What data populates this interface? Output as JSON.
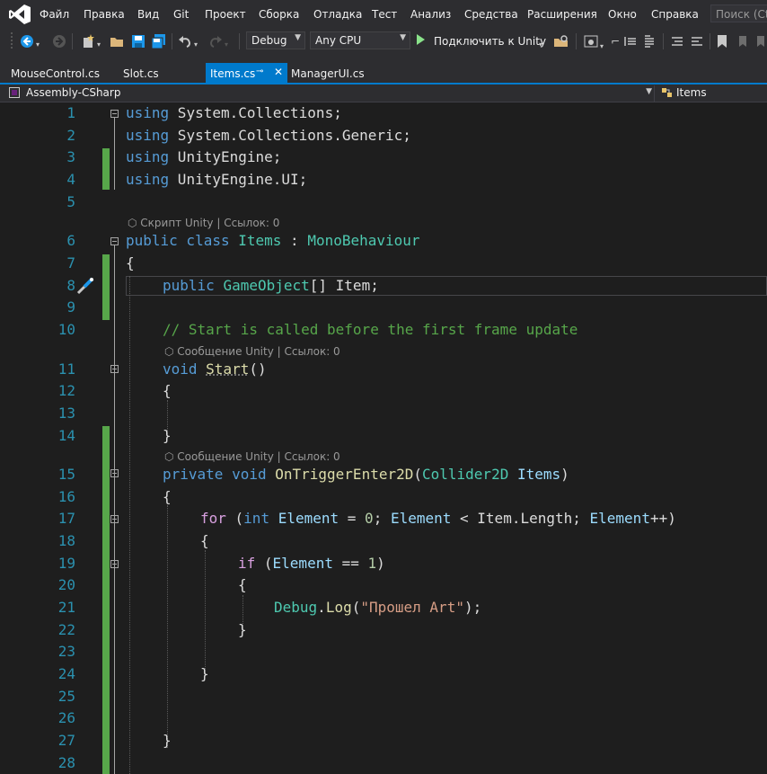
{
  "menu": {
    "items": [
      "Файл",
      "Правка",
      "Вид",
      "Git",
      "Проект",
      "Сборка",
      "Отладка",
      "Тест",
      "Анализ",
      "Средства",
      "Расширения",
      "Окно",
      "Справка"
    ],
    "search_placeholder": "Поиск (Ctrl+Q)"
  },
  "toolbar": {
    "configuration": "Debug",
    "platform": "Any CPU",
    "run_label": "Подключить к Unity"
  },
  "tabs": [
    {
      "label": "MouseControl.cs",
      "active": false
    },
    {
      "label": "Slot.cs",
      "active": false
    },
    {
      "label": "Items.cs",
      "active": true
    },
    {
      "label": "ManagerUI.cs",
      "active": false
    }
  ],
  "navbar": {
    "project": "Assembly-CSharp",
    "type": "Items"
  },
  "lenses": {
    "class_lens": "Скрипт Unity | Ссылок: 0",
    "start_lens": "Сообщение Unity | Ссылок: 0",
    "trigger_lens": "Сообщение Unity | Ссылок: 0"
  },
  "code": {
    "line_numbers": [
      "1",
      "2",
      "3",
      "4",
      "5",
      "6",
      "7",
      "8",
      "9",
      "10",
      "11",
      "12",
      "13",
      "14",
      "15",
      "16",
      "17",
      "18",
      "19",
      "20",
      "21",
      "22",
      "23",
      "24",
      "25",
      "26",
      "27",
      "28"
    ],
    "l1_kw": "using",
    "l1_rest": " System.Collections;",
    "l2_kw": "using",
    "l2_rest": " System.Collections.Generic;",
    "l3_kw": "using",
    "l3_rest": " UnityEngine;",
    "l4_kw": "using",
    "l4_rest": " UnityEngine.UI;",
    "l6_kw1": "public",
    "l6_kw2": " class ",
    "l6_name": "Items",
    "l6_colon": " : ",
    "l6_base": "MonoBehaviour",
    "l7": "{",
    "l8_kw": "public",
    "l8_type": "GameObject",
    "l8_rest": "[] Item;",
    "l10": "// Start is called before the first frame update",
    "l11_kw": "void",
    "l11_name": "Start",
    "l11_rest": "()",
    "l12": "{",
    "l14": "}",
    "l15_kw1": "private",
    "l15_kw2": " void ",
    "l15_name": "OnTriggerEnter2D",
    "l15_p1": "(",
    "l15_type": "Collider2D",
    "l15_arg": " Items",
    "l15_p2": ")",
    "l16": "{",
    "l17_for": "for",
    "l17_a": " (",
    "l17_int": "int",
    "l17_var1": " Element",
    "l17_b": " = ",
    "l17_num": "0",
    "l17_c": "; ",
    "l17_var2": "Element",
    "l17_d": " < Item.Length; ",
    "l17_var3": "Element",
    "l17_e": "++)",
    "l18": "{",
    "l19_if": "if",
    "l19_a": " (",
    "l19_var": "Element",
    "l19_b": " == ",
    "l19_num": "1",
    "l19_c": ")",
    "l20": "{",
    "l21_type": "Debug",
    "l21_dot": ".",
    "l21_method": "Log",
    "l21_p1": "(",
    "l21_str": "\"Прошел Art\"",
    "l21_p2": ");",
    "l22": "}",
    "l24": "}",
    "l27": "}"
  },
  "colors": {
    "accent": "#007acc",
    "keyword": "#569cd6",
    "type": "#4ec9b0",
    "comment": "#57a64a",
    "string": "#d69d85",
    "line_number": "#2b91af",
    "change_bar": "#57a64a"
  }
}
